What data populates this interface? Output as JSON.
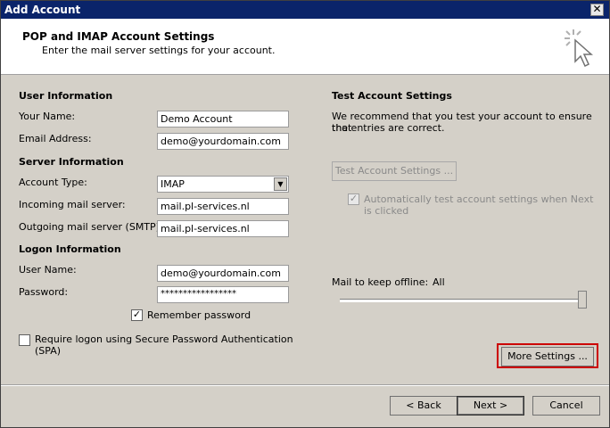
{
  "window": {
    "title": "Add Account",
    "close_glyph": "✕"
  },
  "header": {
    "title": "POP and IMAP Account Settings",
    "subtitle": "Enter the mail server settings for your account."
  },
  "user_info": {
    "section": "User Information",
    "name_label": "Your Name:",
    "name_value": "Demo Account",
    "email_label": "Email Address:",
    "email_value": "demo@yourdomain.com"
  },
  "server_info": {
    "section": "Server Information",
    "account_type_label": "Account Type:",
    "account_type_value": "IMAP",
    "incoming_label": "Incoming mail server:",
    "incoming_value": "mail.pl-services.nl",
    "outgoing_label": "Outgoing mail server (SMTP):",
    "outgoing_value": "mail.pl-services.nl"
  },
  "logon_info": {
    "section": "Logon Information",
    "username_label": "User Name:",
    "username_value": "demo@yourdomain.com",
    "password_label": "Password:",
    "password_value": "*****************",
    "remember_label": "Remember password",
    "remember_checked": true,
    "spa_label_line1": "Require logon using Secure Password Authentication",
    "spa_label_line2": "(SPA)",
    "spa_checked": false
  },
  "test_settings": {
    "section": "Test Account Settings",
    "description_line1": "We recommend that you test your account to ensure that",
    "description_line2": "the entries are correct.",
    "test_button": "Test Account Settings ...",
    "auto_test_line1": "Automatically test account settings when Next",
    "auto_test_line2": "is clicked",
    "auto_test_checked": true
  },
  "offline": {
    "label": "Mail to keep offline:",
    "value": "All",
    "slider_fraction": 1.0
  },
  "buttons": {
    "more_settings": "More Settings ...",
    "back": "< Back",
    "next": "Next >",
    "cancel": "Cancel"
  },
  "colors": {
    "titlebar": "#0a246a",
    "dialog": "#d4d0c8",
    "highlight": "#cc0000"
  }
}
